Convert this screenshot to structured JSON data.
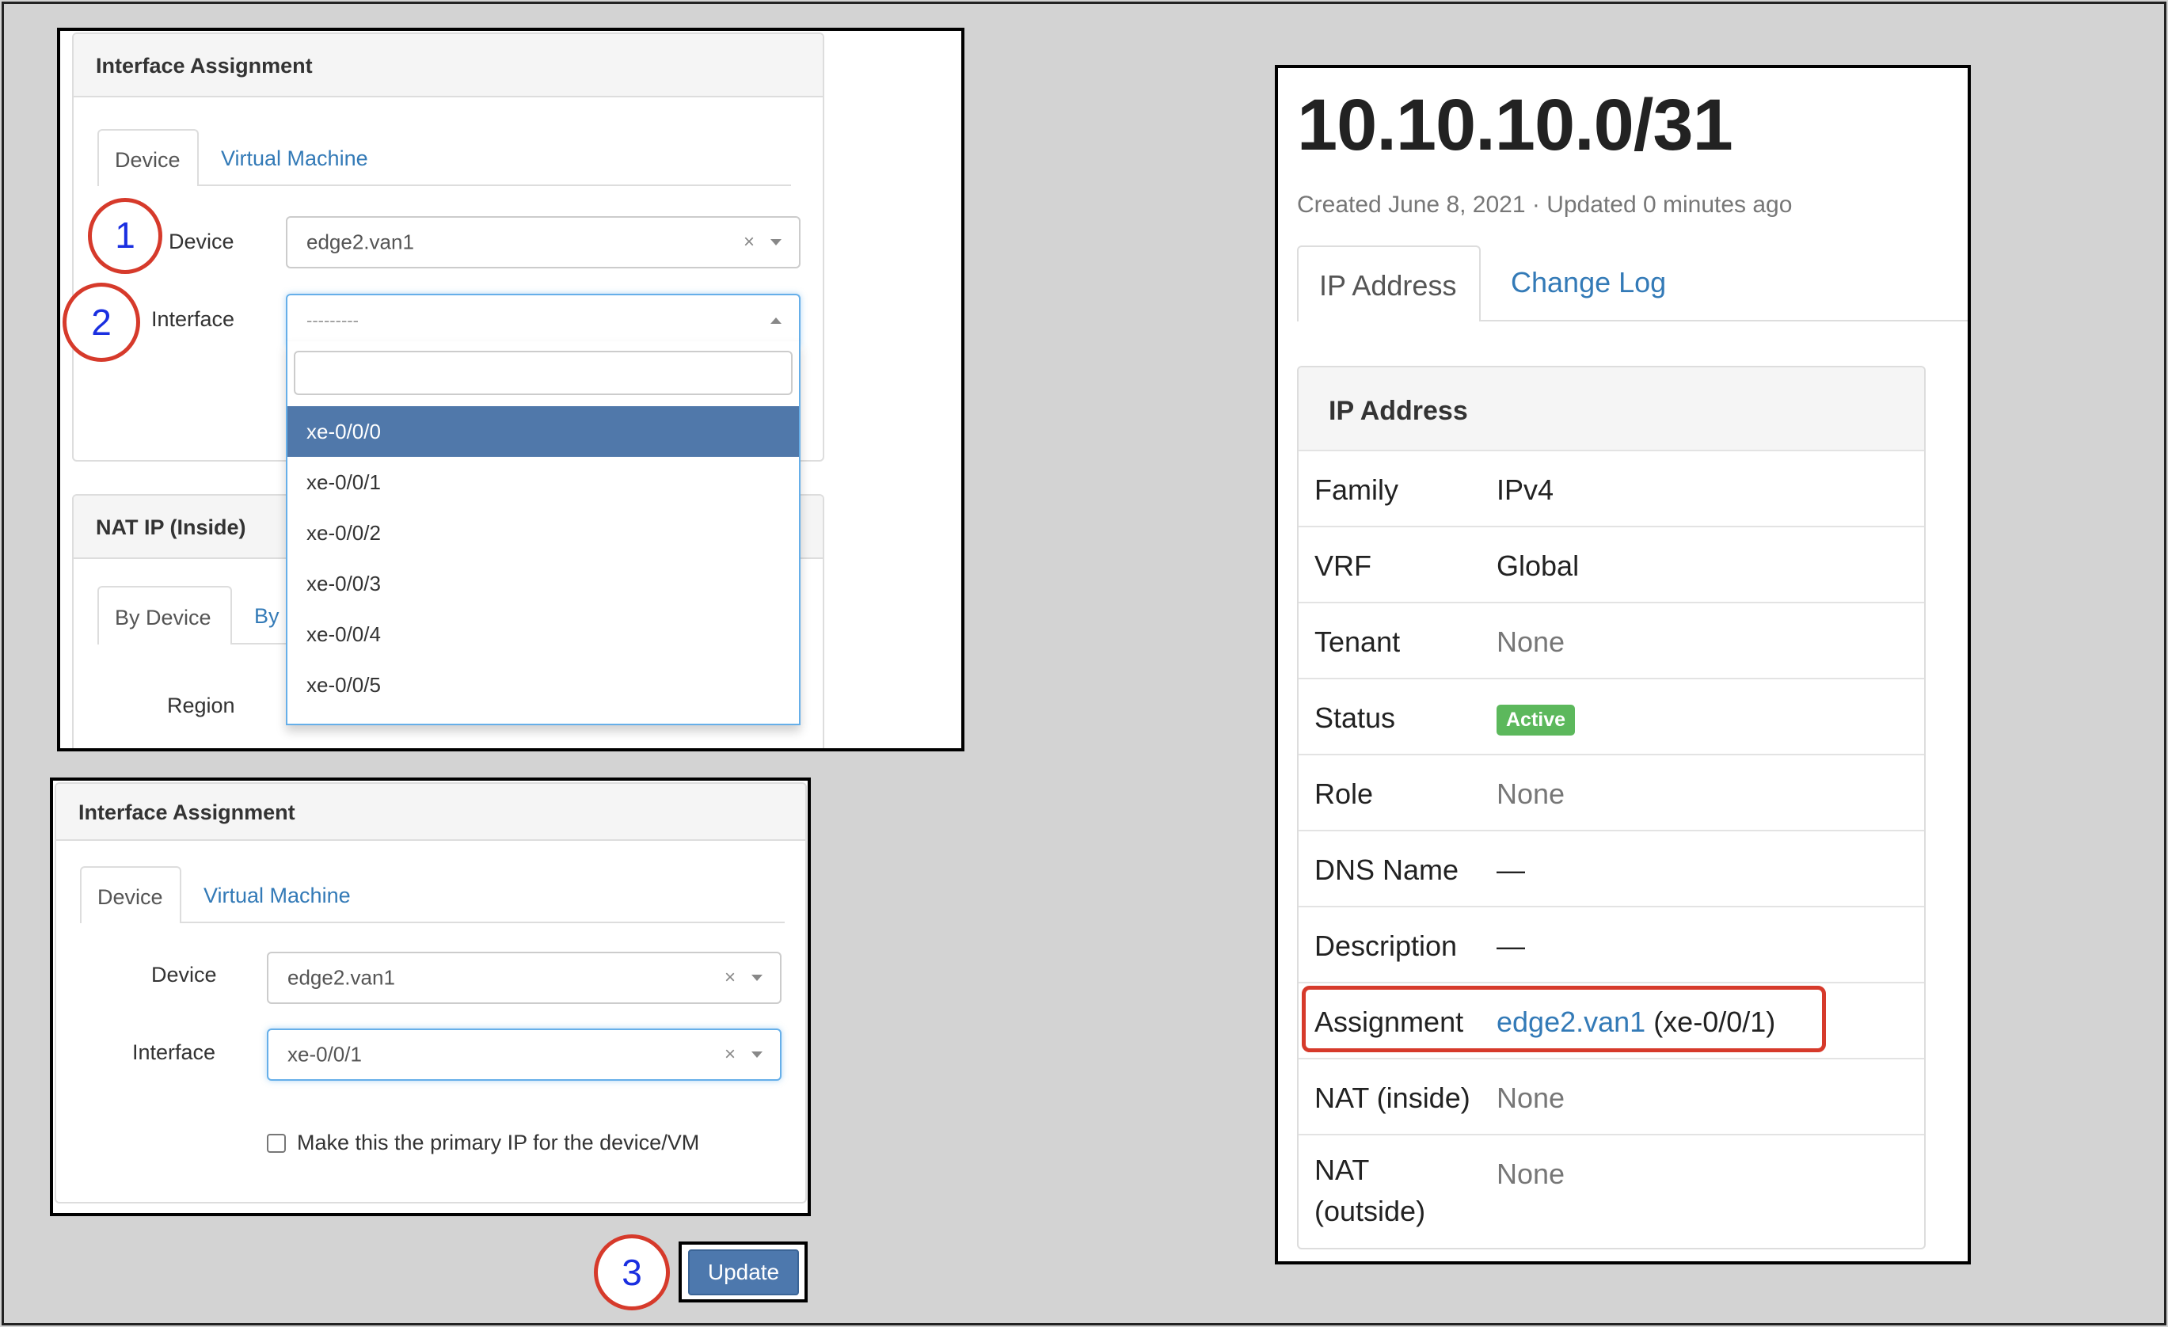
{
  "annotations": {
    "step1": "1",
    "step2": "2",
    "step3": "3"
  },
  "top_left": {
    "interface_assignment": {
      "header": "Interface Assignment",
      "tabs": [
        {
          "label": "Device",
          "active": true
        },
        {
          "label": "Virtual Machine",
          "active": false
        }
      ],
      "device_label": "Device",
      "device_value": "edge2.van1",
      "interface_label": "Interface",
      "interface_placeholder": "---------",
      "search_value": "",
      "options": [
        "xe-0/0/0",
        "xe-0/0/1",
        "xe-0/0/2",
        "xe-0/0/3",
        "xe-0/0/4",
        "xe-0/0/5"
      ],
      "highlighted_option": "xe-0/0/0",
      "clear_glyph": "×"
    },
    "nat_ip": {
      "header": "NAT IP (Inside)",
      "tabs": [
        {
          "label": "By Device",
          "active": true
        },
        {
          "label": "By",
          "active": false
        }
      ],
      "region_label": "Region"
    }
  },
  "bottom_left": {
    "header": "Interface Assignment",
    "tabs": [
      {
        "label": "Device",
        "active": true
      },
      {
        "label": "Virtual Machine",
        "active": false
      }
    ],
    "device_label": "Device",
    "device_value": "edge2.van1",
    "interface_label": "Interface",
    "interface_value": "xe-0/0/1",
    "clear_glyph": "×",
    "primary_checkbox_label": "Make this the primary IP for the device/VM",
    "primary_checked": false,
    "update_button": "Update"
  },
  "right": {
    "title": "10.10.10.0/31",
    "subtitle": "Created June 8, 2021 · Updated 0 minutes ago",
    "tabs": [
      {
        "label": "IP Address",
        "active": true
      },
      {
        "label": "Change Log",
        "active": false
      }
    ],
    "panel_header": "IP Address",
    "rows": [
      {
        "key": "Family",
        "value": "IPv4"
      },
      {
        "key": "VRF",
        "value": "Global"
      },
      {
        "key": "Tenant",
        "value": "None"
      },
      {
        "key": "Status",
        "value": "Active"
      },
      {
        "key": "Role",
        "value": "None"
      },
      {
        "key": "DNS Name",
        "value": "—"
      },
      {
        "key": "Description",
        "value": "—"
      },
      {
        "key": "Assignment",
        "value_link": "edge2.van1",
        "value_suffix": " (xe-0/0/1)"
      },
      {
        "key": "NAT (inside)",
        "value": "None"
      },
      {
        "key": "NAT (outside)",
        "key_line1": "NAT",
        "key_line2": "(outside)",
        "value": "None"
      }
    ],
    "colors": {
      "status_active": "#5cb85c",
      "link": "#337ab7",
      "highlight": "#d63a2b"
    }
  }
}
